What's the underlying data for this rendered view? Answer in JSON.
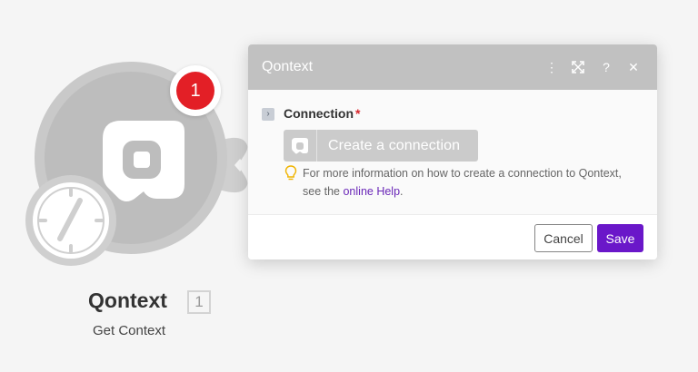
{
  "module": {
    "title": "Qontext",
    "count": "1",
    "subtitle": "Get Context",
    "badge": "1"
  },
  "panel": {
    "title": "Qontext",
    "icons": [
      "more-vertical-icon",
      "maximize-icon",
      "help-icon",
      "close-icon"
    ],
    "connection_label": "Connection",
    "required_mark": "*",
    "create_connection_label": "Create a connection",
    "help_text_before": "For more information on how to create a connection to Qontext, see the ",
    "help_link": "online Help",
    "help_text_after": ".",
    "cancel_label": "Cancel",
    "save_label": "Save"
  },
  "colors": {
    "accent": "#6a17c9",
    "badge": "#e31f26",
    "header": "#c1c1c1"
  }
}
